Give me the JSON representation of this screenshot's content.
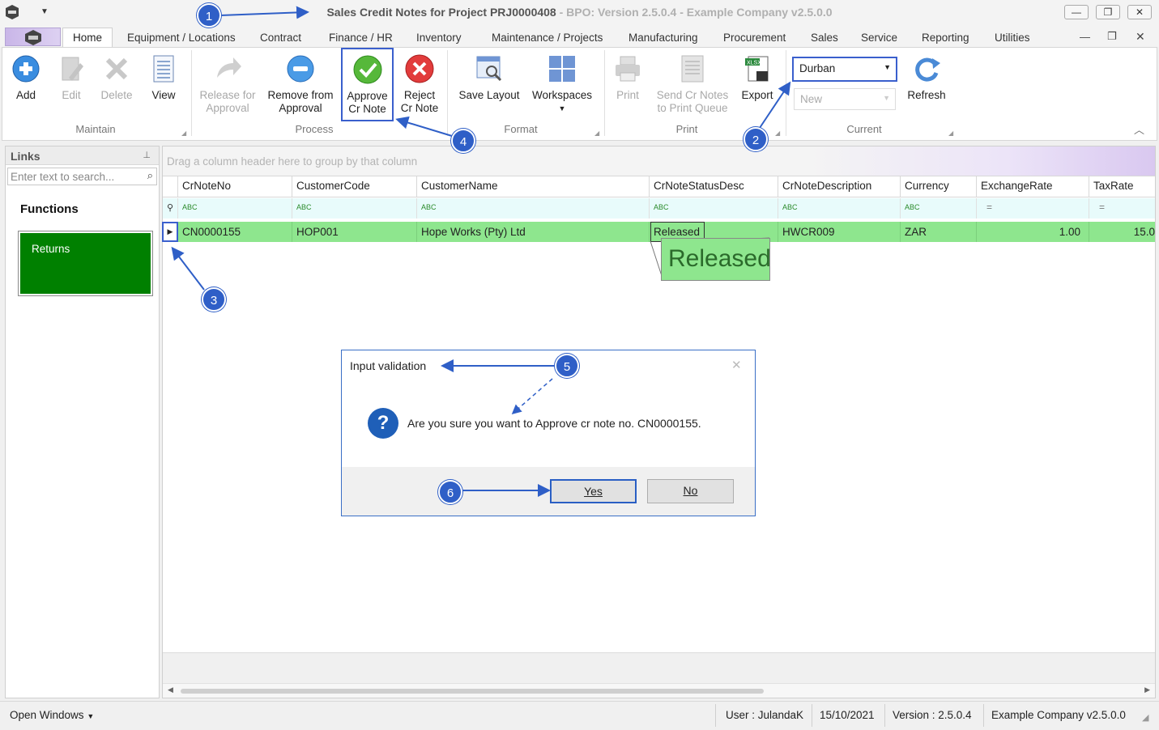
{
  "window": {
    "title": "Sales Credit Notes for Project PRJ0000408",
    "subtitle": "- BPO: Version 2.5.0.4 - Example Company v2.5.0.0",
    "buttons": [
      "—",
      "❐",
      "✕"
    ]
  },
  "tabs": [
    "Home",
    "Equipment / Locations",
    "Contract",
    "Finance / HR",
    "Inventory",
    "Maintenance / Projects",
    "Manufacturing",
    "Procurement",
    "Sales",
    "Service",
    "Reporting",
    "Utilities"
  ],
  "ribbon": {
    "maintain": {
      "label": "Maintain",
      "add": "Add",
      "edit": "Edit",
      "delete": "Delete",
      "view": "View"
    },
    "process": {
      "label": "Process",
      "release_1": "Release for",
      "release_2": "Approval",
      "remove_1": "Remove from",
      "remove_2": "Approval",
      "approve_1": "Approve",
      "approve_2": "Cr Note",
      "reject_1": "Reject",
      "reject_2": "Cr Note"
    },
    "format": {
      "label": "Format",
      "save_layout": "Save Layout",
      "workspaces": "Workspaces"
    },
    "print": {
      "label": "Print",
      "print": "Print",
      "send_1": "Send Cr Notes",
      "send_2": "to Print Queue",
      "export": "Export"
    },
    "current": {
      "label": "Current",
      "site": "Durban",
      "status": "New",
      "refresh": "Refresh"
    }
  },
  "links": {
    "title": "Links",
    "search_placeholder": "Enter text to search...",
    "functions": "Functions",
    "item": "Returns"
  },
  "grid": {
    "group_hint": "Drag a column header here to group by that column",
    "filter_text": "ABC",
    "filter_eq": "=",
    "columns": [
      "CrNoteNo",
      "CustomerCode",
      "CustomerName",
      "CrNoteStatusDesc",
      "CrNoteDescription",
      "Currency",
      "ExchangeRate",
      "TaxRate"
    ],
    "row": {
      "CrNoteNo": "CN0000155",
      "CustomerCode": "HOP001",
      "CustomerName": "Hope Works (Pty) Ltd",
      "CrNoteStatusDesc": "Released",
      "CrNoteDescription": "HWCR009",
      "Currency": "ZAR",
      "ExchangeRate": "1.00",
      "TaxRate": "15.0"
    },
    "zoom_text": "Released"
  },
  "dialog": {
    "title": "Input validation",
    "message": "Are you sure you want to Approve cr note no. CN0000155.",
    "yes": "Yes",
    "no": "No"
  },
  "statusbar": {
    "open_windows": "Open Windows",
    "user": "User : JulandaK",
    "date": "15/10/2021",
    "version": "Version : 2.5.0.4",
    "company": "Example Company v2.5.0.0"
  },
  "markers": [
    "1",
    "2",
    "3",
    "4",
    "5",
    "6"
  ],
  "colors": {
    "accent": "#2f5fc7",
    "released_row": "#8ee68e",
    "returns_tile": "#008000"
  }
}
